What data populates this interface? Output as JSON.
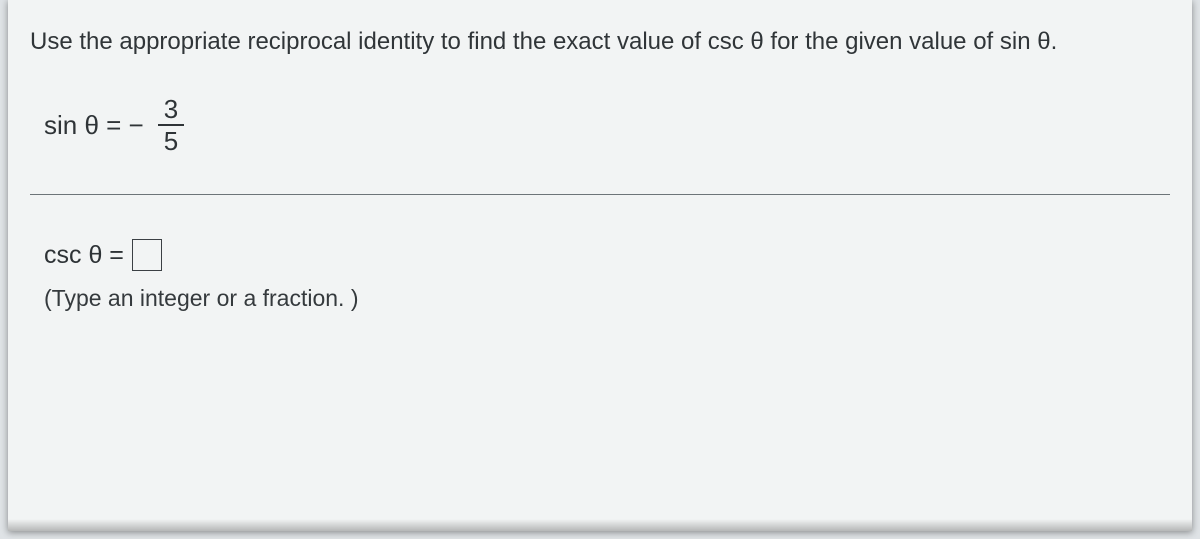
{
  "question": {
    "prompt": "Use the appropriate reciprocal identity to find the exact value of csc θ for the given value of sin θ.",
    "given": {
      "lhs": "sin θ = −",
      "numerator": "3",
      "denominator": "5"
    }
  },
  "answer": {
    "lhs": "csc θ =",
    "value": "",
    "hint": "(Type an integer or a fraction. )"
  }
}
